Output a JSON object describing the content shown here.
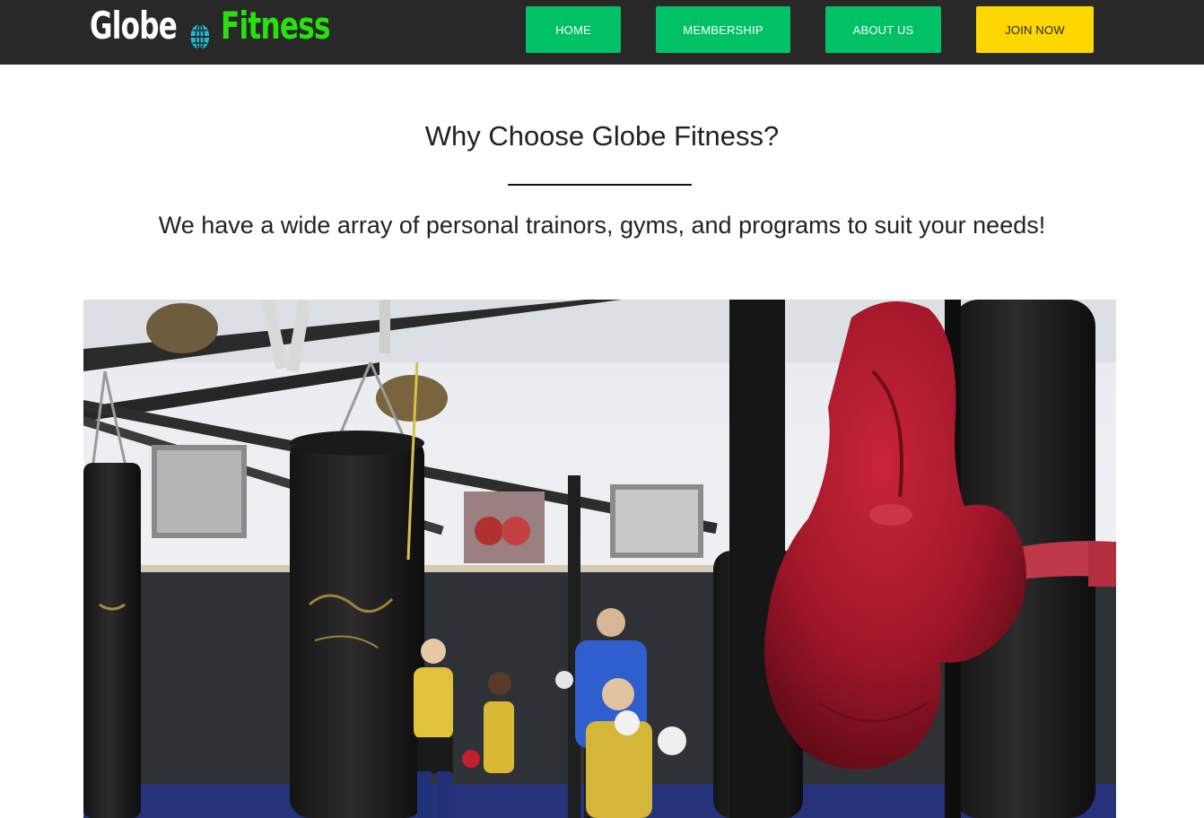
{
  "brand": {
    "name_part1": "Globe",
    "name_part2": "Fitness",
    "icon": "globe-icon"
  },
  "nav": {
    "home": "HOME",
    "membership": "MEMBERSHIP",
    "about": "ABOUT US",
    "join": "JOIN NOW"
  },
  "main": {
    "heading": "Why Choose Globe Fitness?",
    "subheading": "We have a wide array of personal trainors, gyms, and programs to suit your needs!"
  },
  "hero": {
    "image_alt": "Boxing gym with punching bags, a red boxing glove and kids training"
  },
  "colors": {
    "nav_background": "#282828",
    "nav_button": "#00c264",
    "join_button": "#ffd700",
    "brand_accent": "#27e20f",
    "globe_icon": "#1fb8d8"
  }
}
